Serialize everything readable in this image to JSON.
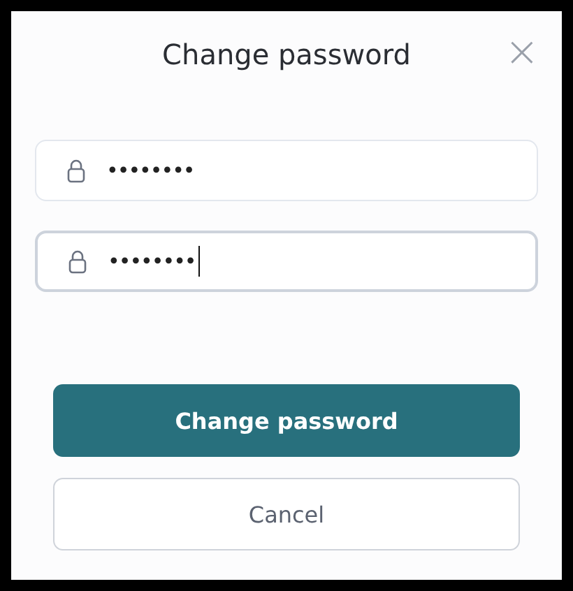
{
  "dialog": {
    "title": "Change password",
    "close": "×"
  },
  "fields": [
    {
      "value": "••••••••",
      "focused": false
    },
    {
      "value": "••••••••",
      "focused": true
    }
  ],
  "buttons": [
    {
      "label": "Change password",
      "kind": "primary"
    },
    {
      "label": "Cancel",
      "kind": "secondary"
    }
  ]
}
